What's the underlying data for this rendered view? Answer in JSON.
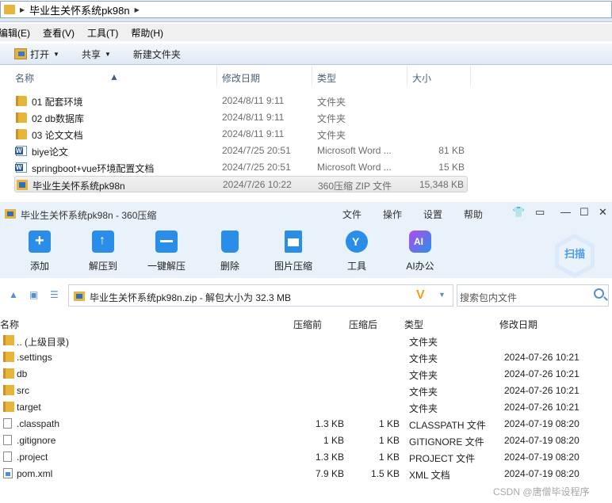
{
  "explorer": {
    "breadcrumb": "毕业生关怀系统pk98n",
    "menu": [
      "编辑(E)",
      "查看(V)",
      "工具(T)",
      "帮助(H)"
    ],
    "toolbar": {
      "open": "打开",
      "share": "共享",
      "new_folder": "新建文件夹"
    },
    "columns": {
      "name": "名称",
      "date": "修改日期",
      "type": "类型",
      "size": "大小"
    },
    "files": [
      {
        "icon": "folder-icon",
        "name": "01 配套环境",
        "date": "2024/8/11 9:11",
        "type": "文件夹",
        "size": ""
      },
      {
        "icon": "folder-icon",
        "name": "02 db数据库",
        "date": "2024/8/11 9:11",
        "type": "文件夹",
        "size": ""
      },
      {
        "icon": "folder-icon",
        "name": "03 论文文档",
        "date": "2024/8/11 9:11",
        "type": "文件夹",
        "size": ""
      },
      {
        "icon": "word-doc-icon",
        "name": "biye论文",
        "date": "2024/7/25 20:51",
        "type": "Microsoft Word ...",
        "size": "81 KB"
      },
      {
        "icon": "word-doc-icon",
        "name": "springboot+vue环境配置文档",
        "date": "2024/7/25 20:51",
        "type": "Microsoft Word ...",
        "size": "15 KB"
      },
      {
        "icon": "zip-archive-icon",
        "name": "毕业生关怀系统pk98n",
        "date": "2024/7/26 10:22",
        "type": "360压缩 ZIP 文件",
        "size": "15,348 KB",
        "selected": true
      }
    ]
  },
  "zip": {
    "title": "毕业生关怀系统pk98n - 360压缩",
    "menus": [
      "文件",
      "操作",
      "设置",
      "帮助"
    ],
    "tools": [
      "添加",
      "解压到",
      "一键解压",
      "删除",
      "图片压缩",
      "工具",
      "AI办公"
    ],
    "scan": "扫描",
    "path": "毕业生关怀系统pk98n.zip - 解包大小为 32.3 MB",
    "search_placeholder": "搜索包内文件",
    "columns": {
      "name": "名称",
      "compressed_before": "压缩前",
      "compressed_after": "压缩后",
      "type": "类型",
      "date": "修改日期"
    },
    "files": [
      {
        "icon": "folder-icon",
        "name": ".. (上级目录)",
        "before": "",
        "after": "",
        "type": "文件夹",
        "date": ""
      },
      {
        "icon": "folder-icon",
        "name": ".settings",
        "before": "",
        "after": "",
        "type": "文件夹",
        "date": "2024-07-26 10:21"
      },
      {
        "icon": "folder-icon",
        "name": "db",
        "before": "",
        "after": "",
        "type": "文件夹",
        "date": "2024-07-26 10:21"
      },
      {
        "icon": "folder-icon",
        "name": "src",
        "before": "",
        "after": "",
        "type": "文件夹",
        "date": "2024-07-26 10:21"
      },
      {
        "icon": "folder-icon",
        "name": "target",
        "before": "",
        "after": "",
        "type": "文件夹",
        "date": "2024-07-26 10:21"
      },
      {
        "icon": "file-icon",
        "name": ".classpath",
        "before": "1.3 KB",
        "after": "1 KB",
        "type": "CLASSPATH 文件",
        "date": "2024-07-19 08:20"
      },
      {
        "icon": "file-icon",
        "name": ".gitignore",
        "before": "1 KB",
        "after": "1 KB",
        "type": "GITIGNORE 文件",
        "date": "2024-07-19 08:20"
      },
      {
        "icon": "file-icon",
        "name": ".project",
        "before": "1.3 KB",
        "after": "1 KB",
        "type": "PROJECT 文件",
        "date": "2024-07-19 08:20"
      },
      {
        "icon": "xml-file-icon",
        "name": "pom.xml",
        "before": "7.9 KB",
        "after": "1.5 KB",
        "type": "XML 文档",
        "date": "2024-07-19 08:20"
      }
    ]
  },
  "watermark": "CSDN @唐僧毕设程序"
}
